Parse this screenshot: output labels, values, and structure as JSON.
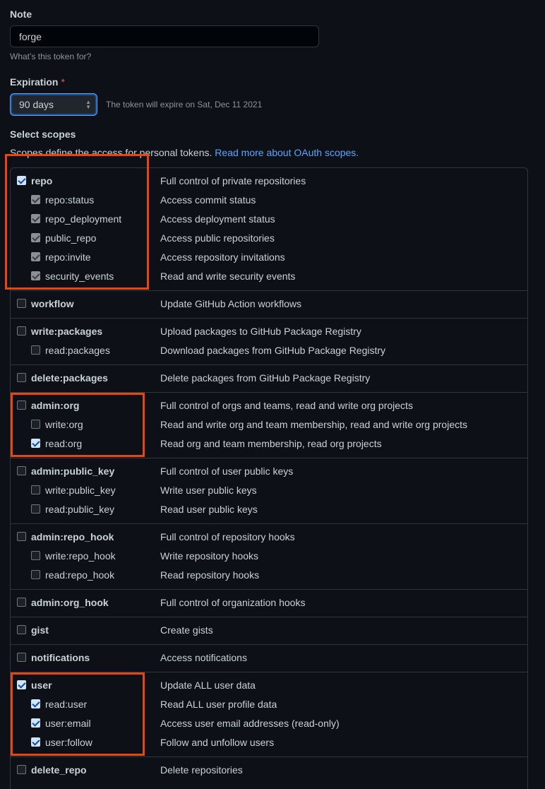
{
  "note": {
    "label": "Note",
    "value": "forge",
    "hint": "What’s this token for?"
  },
  "expiration": {
    "label": "Expiration",
    "required": "*",
    "selected": "90 days",
    "note": "The token will expire on Sat, Dec 11 2021"
  },
  "scopes_section": {
    "title": "Select scopes",
    "description": "Scopes define the access for personal tokens.",
    "link": "Read more about OAuth scopes."
  },
  "colors": {
    "highlight": "#e8460f",
    "link": "#58a6ff",
    "checked": "#d2e4fb"
  },
  "groups": [
    {
      "name": "repo",
      "desc": "Full control of private repositories",
      "checked": true,
      "highlight": true,
      "children": [
        {
          "name": "repo:status",
          "desc": "Access commit status",
          "state": "inherited"
        },
        {
          "name": "repo_deployment",
          "desc": "Access deployment status",
          "state": "inherited"
        },
        {
          "name": "public_repo",
          "desc": "Access public repositories",
          "state": "inherited"
        },
        {
          "name": "repo:invite",
          "desc": "Access repository invitations",
          "state": "inherited"
        },
        {
          "name": "security_events",
          "desc": "Read and write security events",
          "state": "inherited"
        }
      ]
    },
    {
      "name": "workflow",
      "desc": "Update GitHub Action workflows",
      "checked": false,
      "children": []
    },
    {
      "name": "write:packages",
      "desc": "Upload packages to GitHub Package Registry",
      "checked": false,
      "children": [
        {
          "name": "read:packages",
          "desc": "Download packages from GitHub Package Registry",
          "state": "off"
        }
      ]
    },
    {
      "name": "delete:packages",
      "desc": "Delete packages from GitHub Package Registry",
      "checked": false,
      "children": []
    },
    {
      "name": "admin:org",
      "desc": "Full control of orgs and teams, read and write org projects",
      "checked": false,
      "highlight": true,
      "children": [
        {
          "name": "write:org",
          "desc": "Read and write org and team membership, read and write org projects",
          "state": "off"
        },
        {
          "name": "read:org",
          "desc": "Read org and team membership, read org projects",
          "state": "on"
        }
      ]
    },
    {
      "name": "admin:public_key",
      "desc": "Full control of user public keys",
      "checked": false,
      "children": [
        {
          "name": "write:public_key",
          "desc": "Write user public keys",
          "state": "off"
        },
        {
          "name": "read:public_key",
          "desc": "Read user public keys",
          "state": "off"
        }
      ]
    },
    {
      "name": "admin:repo_hook",
      "desc": "Full control of repository hooks",
      "checked": false,
      "children": [
        {
          "name": "write:repo_hook",
          "desc": "Write repository hooks",
          "state": "off"
        },
        {
          "name": "read:repo_hook",
          "desc": "Read repository hooks",
          "state": "off"
        }
      ]
    },
    {
      "name": "admin:org_hook",
      "desc": "Full control of organization hooks",
      "checked": false,
      "children": []
    },
    {
      "name": "gist",
      "desc": "Create gists",
      "checked": false,
      "children": []
    },
    {
      "name": "notifications",
      "desc": "Access notifications",
      "checked": false,
      "children": []
    },
    {
      "name": "user",
      "desc": "Update ALL user data",
      "checked": true,
      "highlight": true,
      "children": [
        {
          "name": "read:user",
          "desc": "Read ALL user profile data",
          "state": "on"
        },
        {
          "name": "user:email",
          "desc": "Access user email addresses (read-only)",
          "state": "on"
        },
        {
          "name": "user:follow",
          "desc": "Follow and unfollow users",
          "state": "on"
        }
      ]
    },
    {
      "name": "delete_repo",
      "desc": "Delete repositories",
      "checked": false,
      "children": []
    }
  ]
}
